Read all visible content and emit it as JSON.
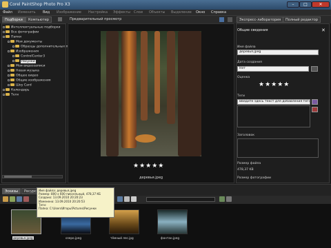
{
  "title": "Corel PaintShop Photo Pro X3",
  "menu": [
    "Файл",
    "Изменить",
    "Вид",
    "Изображение",
    "Настройка",
    "Эффекты",
    "Слои",
    "Объекты",
    "Выделение",
    "Окно",
    "Справка"
  ],
  "left_tabs": {
    "tab1": "Подборки",
    "tab2": "Компьютер"
  },
  "preview_label": "Предварительный просмотр",
  "top_right_tabs": {
    "express": "Экспресс-лаборатория",
    "full": "Полный редактор"
  },
  "tree": [
    {
      "label": "Интеллектуальные подборки",
      "depth": 0,
      "icon": "folder"
    },
    {
      "label": "Все фотографии",
      "depth": 0,
      "icon": "folder"
    },
    {
      "label": "Папки",
      "depth": 0,
      "icon": "folder"
    },
    {
      "label": "Мои документы",
      "depth": 1,
      "icon": "folder"
    },
    {
      "label": "Образцы дополнительных п",
      "depth": 2,
      "icon": "folder"
    },
    {
      "label": "Изображения",
      "depth": 1,
      "icon": "folder"
    },
    {
      "label": "ControlCenter3",
      "depth": 2,
      "icon": "folder"
    },
    {
      "label": "Рисунки",
      "depth": 2,
      "icon": "folder",
      "selected": true
    },
    {
      "label": "Мои видеозаписи",
      "depth": 1,
      "icon": "folder"
    },
    {
      "label": "Новая музыка",
      "depth": 1,
      "icon": "folder"
    },
    {
      "label": "Общее видео",
      "depth": 1,
      "icon": "folder"
    },
    {
      "label": "Общие изображения",
      "depth": 1,
      "icon": "folder"
    },
    {
      "label": "Шоу Card",
      "depth": 1,
      "icon": "folder"
    },
    {
      "label": "Календарь",
      "depth": 0,
      "icon": "folder"
    },
    {
      "label": "Теги",
      "depth": 0,
      "icon": "folder"
    }
  ],
  "preview": {
    "filename": "деревья.jpeg",
    "rating_stars": "★★★★★"
  },
  "info_panel": {
    "header": "Общие сведения",
    "filename_label": "Имя файла",
    "filename_value": "деревья.jpeg",
    "created_label": "Дата создания",
    "created_value": "Нет",
    "rating_label": "Оценка",
    "rating_stars": "★★★★★",
    "tags_label": "Теги",
    "tags_placeholder": "Введите здесь текст для добавления тегов",
    "caption_label": "Заголовок",
    "filesize_label": "Размер файла",
    "filesize_value": "478,37 KB",
    "photosize_label": "Размер фотографии"
  },
  "bottom_tabs": {
    "tab1": "Эскизы",
    "tab2": "Ресурсы"
  },
  "tooltip": {
    "line1": "Имя файла: деревья.jpeg",
    "line2": "Размер: 800 x 600 пиксельный, 478,37 КБ",
    "line3": "Создано: 13.09.2010 20:20:23",
    "line4": "Изменено: 13.09.2010 20:20:53",
    "line5": "Теги:",
    "line6": "Папка: C:\\Users\\Игорь\\Pictures\\Рисунки"
  },
  "thumbnails": [
    {
      "caption": "деревья.jpeg",
      "selected": true
    },
    {
      "caption": "озеро.jpeg"
    },
    {
      "caption": "тёмный лес.jpg"
    },
    {
      "caption": "фонтан.jpeg"
    }
  ]
}
